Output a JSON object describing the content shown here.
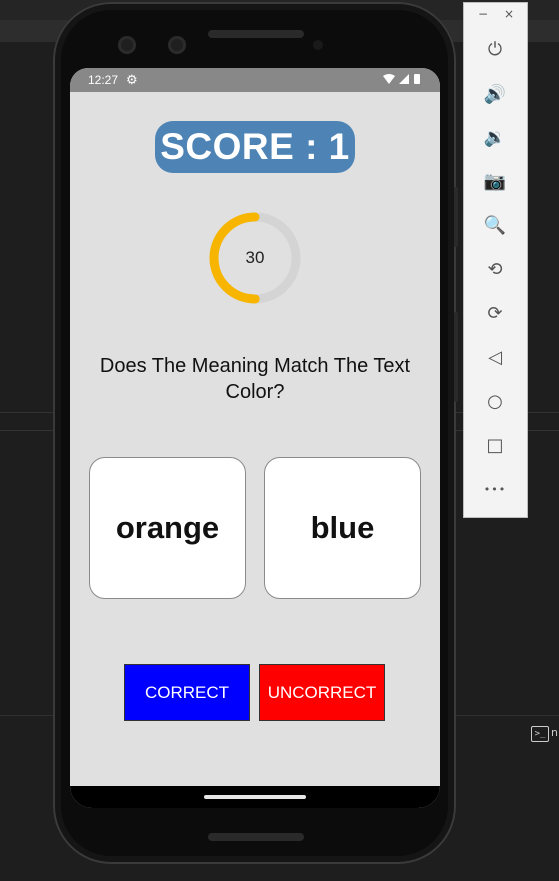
{
  "status_bar": {
    "time": "12:27",
    "settings_icon": "gear-icon",
    "right_icons": "▾◢▮"
  },
  "game": {
    "score_text": "SCORE : 1",
    "timer_value": "30",
    "timer_progress": 0.5,
    "question": "Does The Meaning Match The Text Color?",
    "meaning_word": "orange",
    "color_word": "blue",
    "correct_label": "CORRECT",
    "uncorrect_label": "UNCORRECT"
  },
  "colors": {
    "score_bg": "#4d84b5",
    "timer_arc": "#f7b500",
    "correct_bg": "#0000ff",
    "uncorrect_bg": "#ff0000"
  },
  "emulator_toolbar": {
    "minimize": "−",
    "close": "×",
    "tools": [
      {
        "name": "power-icon",
        "glyph": "⏻"
      },
      {
        "name": "volume-up-icon",
        "glyph": "🔊"
      },
      {
        "name": "volume-down-icon",
        "glyph": "🔉"
      },
      {
        "name": "camera-icon",
        "glyph": "📷"
      },
      {
        "name": "zoom-icon",
        "glyph": "🔍"
      },
      {
        "name": "rotate-left-icon",
        "glyph": "⟲"
      },
      {
        "name": "rotate-right-icon",
        "glyph": "⟳"
      },
      {
        "name": "back-icon",
        "glyph": "◁"
      },
      {
        "name": "home-icon",
        "glyph": "○"
      },
      {
        "name": "overview-icon",
        "glyph": "□"
      },
      {
        "name": "more-icon",
        "glyph": "•••"
      }
    ]
  },
  "terminal": {
    "label": "n"
  }
}
